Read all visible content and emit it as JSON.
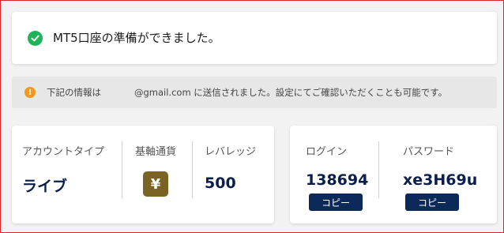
{
  "success": {
    "icon": "check-circle-icon",
    "message": "MT5口座の準備ができました。",
    "color": "#1fb35a"
  },
  "info": {
    "icon": "info-icon",
    "text_before": "下記の情報は",
    "text_after": "@gmail.com に送信されました。設定にてご確認いただくことも可能です。",
    "color": "#f39a1e"
  },
  "account": {
    "type_label": "アカウントタイプ",
    "type_value": "ライブ",
    "currency_label": "基軸通貨",
    "currency_symbol": "¥",
    "leverage_label": "レバレッジ",
    "leverage_value": "500"
  },
  "login": {
    "login_label": "ログイン",
    "login_value": "138694",
    "password_label": "パスワード",
    "password_value": "xe3H69u",
    "copy_label": "コピー",
    "accent": "#0b2a5a"
  }
}
